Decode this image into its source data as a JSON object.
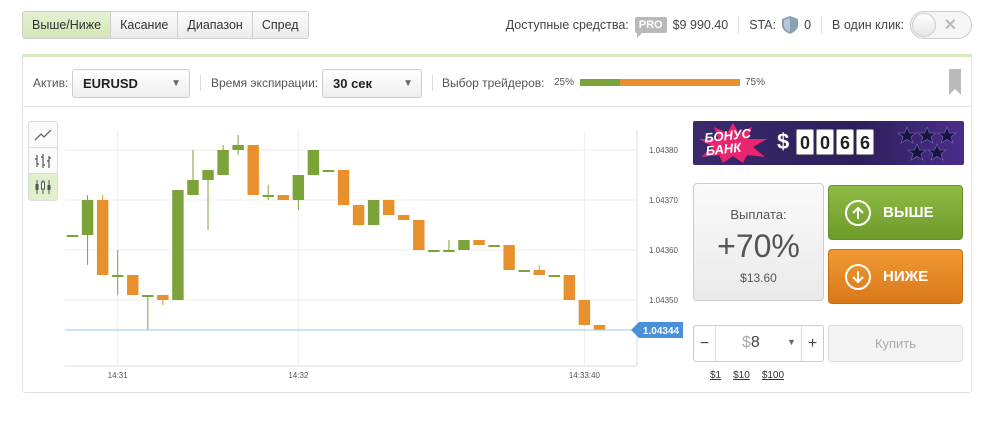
{
  "tabs": [
    {
      "label": "Выше/Ниже",
      "active": true
    },
    {
      "label": "Касание",
      "active": false
    },
    {
      "label": "Диапазон",
      "active": false
    },
    {
      "label": "Спред",
      "active": false
    }
  ],
  "header": {
    "funds_label": "Доступные средства:",
    "pro_badge": "PRO",
    "funds_value": "$9 990.40",
    "sta_label": "STA:",
    "sta_value": "0",
    "one_click_label": "В один клик:",
    "one_click_icon": "close-icon"
  },
  "controls": {
    "asset_label": "Актив:",
    "asset_value": "EURUSD",
    "expiry_label": "Время экспирации:",
    "expiry_value": "30 сек",
    "traders_label": "Выбор трейдеров:",
    "traders_left_pct": "25%",
    "traders_right_pct": "75%",
    "traders_left_fraction": 0.25,
    "colors": {
      "up": "#7ba33a",
      "down": "#e8912c"
    }
  },
  "chart_data": {
    "type": "candlestick",
    "y_ticks": [
      "1.04380",
      "1.04370",
      "1.04360",
      "1.04350"
    ],
    "x_ticks": [
      "14:31",
      "14:32",
      "14:33:40"
    ],
    "ylim": [
      1.04338,
      1.04384
    ],
    "current_price": "1.04344",
    "current_price_value": 1.04344,
    "grid": true,
    "candles": [
      {
        "o": 1.04363,
        "c": 1.04363,
        "h": 1.04363,
        "l": 1.04363
      },
      {
        "o": 1.04363,
        "c": 1.0437,
        "h": 1.04371,
        "l": 1.04357
      },
      {
        "o": 1.0437,
        "c": 1.04355,
        "h": 1.04371,
        "l": 1.04355
      },
      {
        "o": 1.04355,
        "c": 1.04355,
        "h": 1.0436,
        "l": 1.04351
      },
      {
        "o": 1.04355,
        "c": 1.04351,
        "h": 1.04355,
        "l": 1.04351
      },
      {
        "o": 1.04351,
        "c": 1.04351,
        "h": 1.04351,
        "l": 1.04344
      },
      {
        "o": 1.04351,
        "c": 1.0435,
        "h": 1.04351,
        "l": 1.04349
      },
      {
        "o": 1.0435,
        "c": 1.04372,
        "h": 1.04372,
        "l": 1.0435
      },
      {
        "o": 1.04371,
        "c": 1.04374,
        "h": 1.0438,
        "l": 1.04371
      },
      {
        "o": 1.04374,
        "c": 1.04376,
        "h": 1.04376,
        "l": 1.04364
      },
      {
        "o": 1.04375,
        "c": 1.0438,
        "h": 1.04381,
        "l": 1.04375
      },
      {
        "o": 1.0438,
        "c": 1.04381,
        "h": 1.04383,
        "l": 1.04379
      },
      {
        "o": 1.04381,
        "c": 1.04371,
        "h": 1.04381,
        "l": 1.04371
      },
      {
        "o": 1.04371,
        "c": 1.04371,
        "h": 1.04373,
        "l": 1.0437
      },
      {
        "o": 1.04371,
        "c": 1.0437,
        "h": 1.04371,
        "l": 1.0437
      },
      {
        "o": 1.0437,
        "c": 1.04375,
        "h": 1.04375,
        "l": 1.04368
      },
      {
        "o": 1.04375,
        "c": 1.0438,
        "h": 1.0438,
        "l": 1.04375
      },
      {
        "o": 1.04376,
        "c": 1.04376,
        "h": 1.04376,
        "l": 1.04376
      },
      {
        "o": 1.04376,
        "c": 1.04369,
        "h": 1.04376,
        "l": 1.04369
      },
      {
        "o": 1.04369,
        "c": 1.04365,
        "h": 1.04369,
        "l": 1.04365
      },
      {
        "o": 1.04365,
        "c": 1.0437,
        "h": 1.0437,
        "l": 1.04365
      },
      {
        "o": 1.0437,
        "c": 1.04367,
        "h": 1.0437,
        "l": 1.04367
      },
      {
        "o": 1.04367,
        "c": 1.04366,
        "h": 1.04367,
        "l": 1.04366
      },
      {
        "o": 1.04366,
        "c": 1.0436,
        "h": 1.04366,
        "l": 1.0436
      },
      {
        "o": 1.0436,
        "c": 1.0436,
        "h": 1.0436,
        "l": 1.0436
      },
      {
        "o": 1.0436,
        "c": 1.0436,
        "h": 1.04362,
        "l": 1.0436
      },
      {
        "o": 1.0436,
        "c": 1.04362,
        "h": 1.04362,
        "l": 1.0436
      },
      {
        "o": 1.04362,
        "c": 1.04361,
        "h": 1.04362,
        "l": 1.04361
      },
      {
        "o": 1.04361,
        "c": 1.04361,
        "h": 1.04361,
        "l": 1.04361
      },
      {
        "o": 1.04361,
        "c": 1.04356,
        "h": 1.04361,
        "l": 1.04356
      },
      {
        "o": 1.04356,
        "c": 1.04356,
        "h": 1.04356,
        "l": 1.04356
      },
      {
        "o": 1.04356,
        "c": 1.04355,
        "h": 1.04357,
        "l": 1.04355
      },
      {
        "o": 1.04355,
        "c": 1.04355,
        "h": 1.04355,
        "l": 1.04355
      },
      {
        "o": 1.04355,
        "c": 1.0435,
        "h": 1.04355,
        "l": 1.0435
      },
      {
        "o": 1.0435,
        "c": 1.04345,
        "h": 1.0435,
        "l": 1.04345
      },
      {
        "o": 1.04345,
        "c": 1.04344,
        "h": 1.04345,
        "l": 1.04344
      }
    ]
  },
  "side": {
    "bonus_line1": "БОНУС",
    "bonus_line2": "БАНК",
    "bonus_currency": "$",
    "bonus_digits": [
      "0",
      "0",
      "6",
      "6"
    ],
    "payout_label": "Выплата:",
    "payout_value": "+70%",
    "payout_amount": "$13.60",
    "up_label": "ВЫШЕ",
    "down_label": "НИЖЕ",
    "amount_currency": "$",
    "amount_value": "8",
    "minus_label": "−",
    "plus_label": "+",
    "quick_amounts": [
      "$1",
      "$10",
      "$100"
    ],
    "buy_label": "Купить"
  }
}
